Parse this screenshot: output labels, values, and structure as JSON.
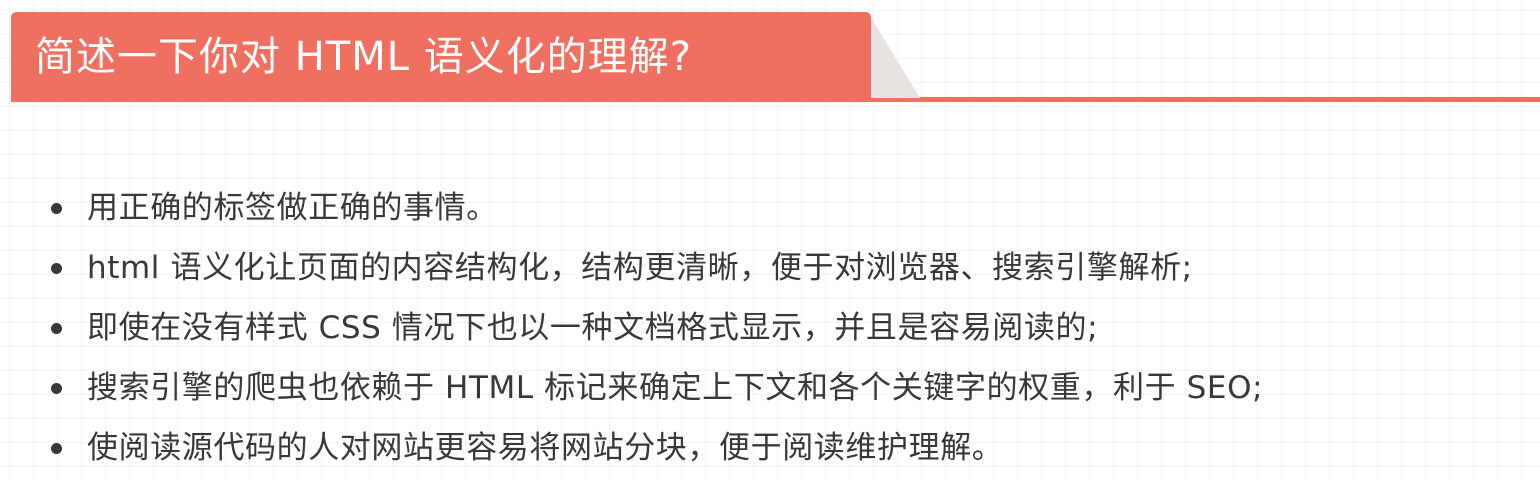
{
  "heading": {
    "title": "简述一下你对 HTML 语义化的理解?"
  },
  "points": [
    "用正确的标签做正确的事情。",
    "html 语义化让页面的内容结构化，结构更清晰，便于对浏览器、搜索引擎解析;",
    "即使在没有样式 CSS 情况下也以一种文档格式显示，并且是容易阅读的;",
    "搜索引擎的爬虫也依赖于 HTML 标记来确定上下文和各个关键字的权重，利于 SEO;",
    "使阅读源代码的人对网站更容易将网站分块，便于阅读维护理解。"
  ],
  "colors": {
    "accent": "#ef7060",
    "text": "#383838",
    "fold": "#e6e3e0"
  }
}
